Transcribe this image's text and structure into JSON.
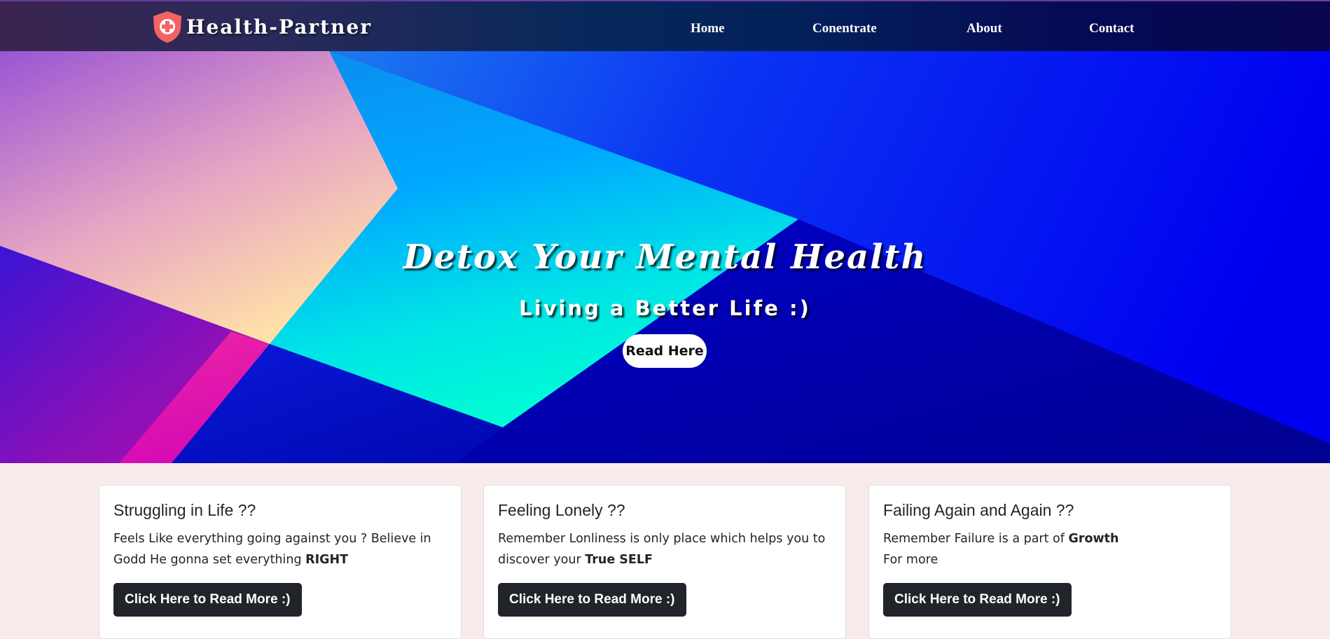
{
  "brand": {
    "name": "Health-Partner",
    "icon": "shield-cross-icon"
  },
  "nav": {
    "items": [
      {
        "label": "Home"
      },
      {
        "label": "Conentrate"
      },
      {
        "label": "About"
      },
      {
        "label": "Contact"
      }
    ]
  },
  "hero": {
    "title": "Detox Your Mental Health",
    "subtitle": "Living a Better Life :)",
    "button_label": "Read Here"
  },
  "cards": [
    {
      "title": "Struggling in Life ??",
      "text_before": "Feels Like everything going against you ? Believe in Godd He gonna set everything ",
      "text_bold": "RIGHT",
      "text_after": "",
      "button_label": "Click Here to Read More :)"
    },
    {
      "title": "Feeling Lonely ??",
      "text_before": "Remember Lonliness is only place which helps you to discover your ",
      "text_bold": "True SELF",
      "text_after": "",
      "button_label": "Click Here to Read More :)"
    },
    {
      "title": "Failing Again and Again ??",
      "text_before": "Remember Failure is a part of ",
      "text_bold": "Growth",
      "text_after": "For more",
      "button_label": "Click Here to Read More :)"
    }
  ],
  "colors": {
    "page_background": "#f8ecea",
    "card_button": "#212529",
    "shield": "#f26464",
    "hero_blue": "#0000f0"
  }
}
